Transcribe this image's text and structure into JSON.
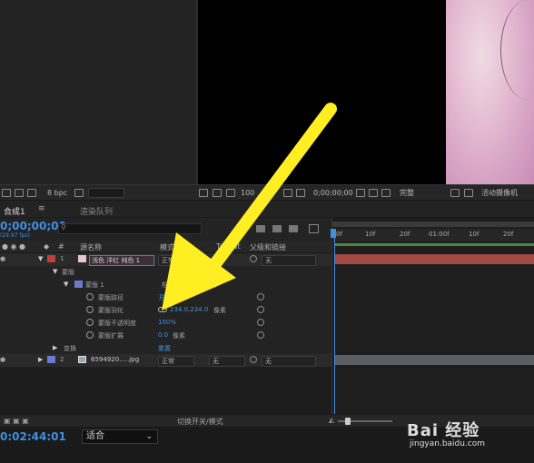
{
  "toolbar": {
    "bpc": "8 bpc",
    "zoom": "100",
    "timecode": "0;00;00;00",
    "quality": "完整",
    "camera": "活动摄像机"
  },
  "tabs": {
    "comp": "合成1",
    "render": "渲染队列"
  },
  "timeline": {
    "timecode": "0;00;00;00",
    "fps": "(29.97 fps)",
    "columns": {
      "source_name": "源名称",
      "mode": "模式",
      "trkmat": "TrkMat",
      "parent": "父级和链接"
    },
    "layer1": {
      "number": "1",
      "name": "浅色 洋红 纯色 1",
      "mode": "正常",
      "parent": "无"
    },
    "props": {
      "masks": "蒙版",
      "mask1": "蒙版 1",
      "mask1_mode": "相",
      "invert": "反转",
      "mask_path": "蒙版路径",
      "mask_path_val": "形状...",
      "mask_feather": "蒙版羽化",
      "mask_feather_val": "234.0,234.0",
      "mask_feather_unit": "像素",
      "mask_opacity": "蒙版不透明度",
      "mask_opacity_val": "100%",
      "mask_expansion": "蒙版扩展",
      "mask_expansion_val": "0.0",
      "mask_expansion_unit": "像素",
      "transform": "变换",
      "reset": "重置"
    },
    "layer2": {
      "number": "2",
      "name": "6594920.....jpg",
      "mode": "正常",
      "trkmat": "无",
      "parent": "无"
    },
    "ruler": [
      "0f",
      "10f",
      "20f",
      "01:00f",
      "10f",
      "20f"
    ],
    "switch_label": "切换开关/模式"
  },
  "footer": {
    "time": "0:02:44:01",
    "fit": "适合"
  },
  "watermark": {
    "brand": "Bai 经验",
    "url": "jingyan.baidu.com"
  },
  "colors": {
    "accent_blue": "#3f8fe0",
    "arrow": "#ffee22",
    "layer1_label": "#c0403a",
    "layer2_label": "#6a7ad0"
  }
}
